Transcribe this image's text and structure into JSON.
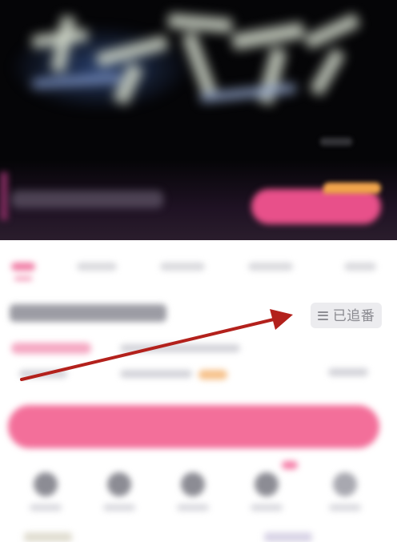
{
  "follow_button": {
    "label": "已追番",
    "icon": "menu-lines-icon"
  },
  "colors": {
    "accent_pink": "#f36f9a",
    "annotation_arrow": "#b3211c",
    "button_bg": "#ececef",
    "button_text": "#8a8a90"
  }
}
